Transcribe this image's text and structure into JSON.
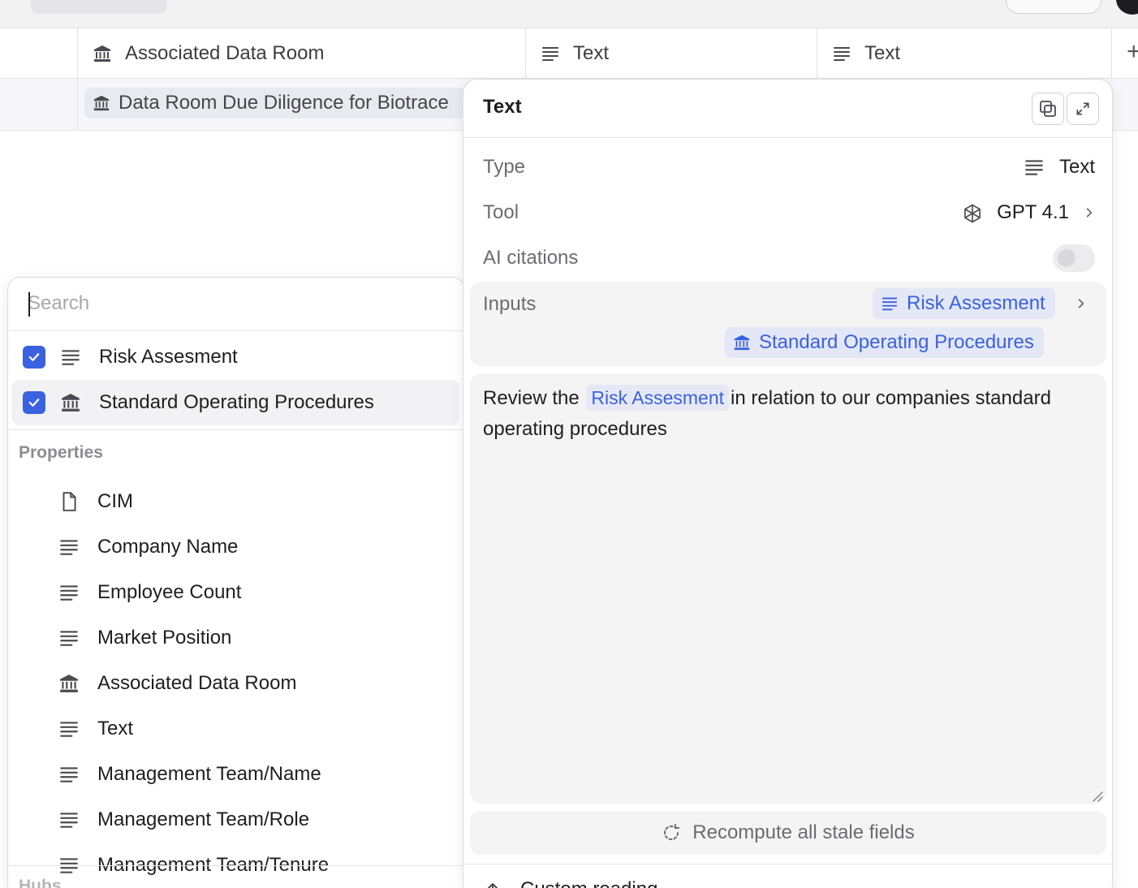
{
  "table": {
    "columns": [
      {
        "label": "Associated Data Room",
        "icon": "bank-icon"
      },
      {
        "label": "Text",
        "icon": "text-lines-icon"
      },
      {
        "label": "Text",
        "icon": "text-lines-icon"
      }
    ],
    "add_column": "+",
    "row": {
      "data_room": "Data Room Due Diligence for Biotrace"
    }
  },
  "dropdown": {
    "search_placeholder": "Search",
    "selected": [
      {
        "label": "Risk Assesment",
        "icon": "text-lines-icon",
        "checked": true
      },
      {
        "label": "Standard Operating Procedures",
        "icon": "bank-icon",
        "checked": true
      }
    ],
    "group_label": "Properties",
    "properties": [
      {
        "label": "CIM",
        "icon": "document-icon"
      },
      {
        "label": "Company Name",
        "icon": "text-lines-icon"
      },
      {
        "label": "Employee Count",
        "icon": "text-lines-icon"
      },
      {
        "label": "Market Position",
        "icon": "text-lines-icon"
      },
      {
        "label": "Associated Data Room",
        "icon": "bank-icon"
      },
      {
        "label": "Text",
        "icon": "text-lines-icon"
      },
      {
        "label": "Management Team/Name",
        "icon": "text-lines-icon"
      },
      {
        "label": "Management Team/Role",
        "icon": "text-lines-icon"
      },
      {
        "label": "Management Team/Tenure",
        "icon": "text-lines-icon"
      }
    ],
    "next_group_label": "Hubs"
  },
  "panel": {
    "title": "Text",
    "type_label": "Type",
    "type_value": "Text",
    "tool_label": "Tool",
    "tool_value": "GPT 4.1",
    "citations_label": "AI citations",
    "citations_enabled": false,
    "inputs_label": "Inputs",
    "inputs": [
      "Risk Assesment",
      "Standard Operating Procedures"
    ],
    "prompt": {
      "before": "Review the",
      "mention": "Risk Assesment",
      "after": "in relation to our companies standard operating procedures"
    },
    "recompute_label": "Recompute all stale fields",
    "footer_label": "Custom reading"
  },
  "colors": {
    "accent": "#3a62e0",
    "chip_bg": "#e3e7f6",
    "muted_text": "#6b6b72"
  }
}
